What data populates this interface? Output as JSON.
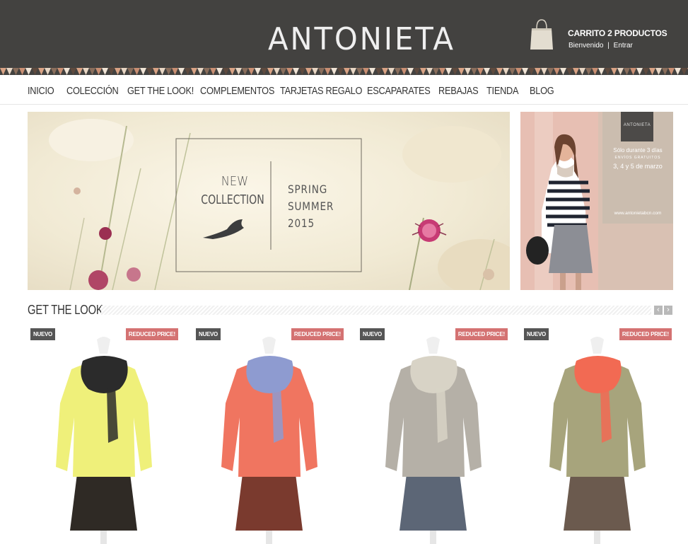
{
  "brand": {
    "logo": "ANTONIETA"
  },
  "cart": {
    "title": "CARRITO 2 PRODUCTOS",
    "welcome": "Bienvenido",
    "separator": "|",
    "login": "Entrar"
  },
  "nav": [
    {
      "label": "INICIO"
    },
    {
      "label": "COLECCIÓN"
    },
    {
      "label": "GET THE LOOK!"
    },
    {
      "label": "COMPLEMENTOS"
    },
    {
      "label": "TARJETAS REGALO"
    },
    {
      "label": "ESCAPARATES"
    },
    {
      "label": "REBAJAS"
    },
    {
      "label": "TIENDA"
    },
    {
      "label": "BLOG"
    }
  ],
  "banner": {
    "line1": "NEW",
    "line2": "COLLECTION",
    "line3": "SPRING",
    "line4": "SUMMER",
    "line5": "2015"
  },
  "promo": {
    "brand": "ANTONIETA",
    "text1": "Sólo durante 3 días",
    "text2": "ENVÍOS GRATUITOS",
    "text3": "3, 4 y 5 de marzo",
    "url": "www.antonietabcn.com"
  },
  "section": {
    "title": "GET THE LOOK",
    "prev": "‹",
    "next": "›"
  },
  "products": [
    {
      "badge_new": "NUEVO",
      "badge_sale": "REDUCED PRICE!",
      "sweater": "#eff07a",
      "scarf": "#2b2b2b",
      "skirt": "#2f2a25"
    },
    {
      "badge_new": "NUEVO",
      "badge_sale": "REDUCED PRICE!",
      "sweater": "#f07560",
      "scarf": "#8e9bd0",
      "skirt": "#7a3a2e"
    },
    {
      "badge_new": "NUEVO",
      "badge_sale": "REDUCED PRICE!",
      "sweater": "#b5b0a7",
      "scarf": "#d8d3c6",
      "skirt": "#5c6676"
    },
    {
      "badge_new": "NUEVO",
      "badge_sale": "REDUCED PRICE!",
      "sweater": "#a7a47c",
      "scarf": "#f26a53",
      "skirt": "#6b5a4e"
    }
  ],
  "colors": {
    "header": "#434240",
    "sale_badge": "#d47272",
    "new_badge": "#555555"
  }
}
